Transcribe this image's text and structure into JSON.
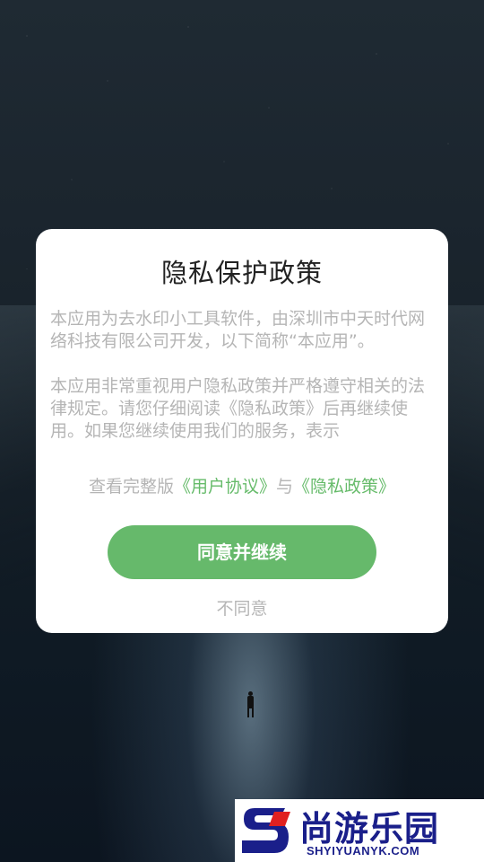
{
  "dialog": {
    "title": "隐私保护政策",
    "paragraphs": [
      "本应用为去水印小工具软件，由深圳市中天时代网络科技有限公司开发，以下简称“本应用”。",
      "本应用非常重视用户隐私政策并严格遵守相关的法律规定。请您仔细阅读《隐私政策》后再继续使用。如果您继续使用我们的服务，表示"
    ],
    "links_prefix": "查看完整版",
    "user_agreement_link": "《用户协议》",
    "links_and": "与",
    "privacy_policy_link": "《隐私政策》",
    "agree_label": "同意并继续",
    "disagree_label": "不同意"
  },
  "watermark": {
    "name": "尚游乐园",
    "url": "SHYIYUANYK.COM"
  },
  "colors": {
    "accent": "#66b96b",
    "link": "#66bb6a",
    "muted_text": "#b5b5b5",
    "watermark_blue": "#1a1f8a",
    "watermark_red": "#e02020"
  }
}
